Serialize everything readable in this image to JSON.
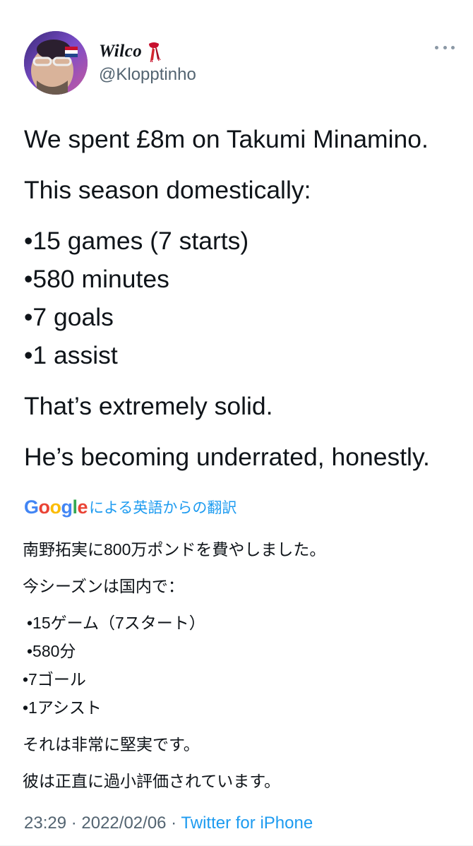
{
  "author": {
    "display_name": "Wilco",
    "handle": "@Klopptinho",
    "avatar_icon": "profile-photo",
    "name_emoji_icon": "red-scarf-icon"
  },
  "tweet": {
    "lines": [
      "We spent £8m on Takumi Minamino.",
      "This season domestically:",
      "•15 games (7 starts)",
      "•580 minutes",
      "•7 goals",
      "•1 assist",
      "That’s extremely solid.",
      "He’s becoming underrated, honestly."
    ]
  },
  "translation": {
    "provider_letters": [
      "G",
      "o",
      "o",
      "g",
      "l",
      "e"
    ],
    "label": "による英語からの翻訳",
    "lines": [
      "南野拓実に800万ポンドを費やしました。",
      "今シーズンは国内で：",
      "•15ゲーム（7スタート）",
      "•580分",
      "•7ゴール",
      "•1アシスト",
      "それは非常に堅実です。",
      "彼は正直に過小評価されています。"
    ]
  },
  "meta": {
    "time": "23:29",
    "separator": " · ",
    "date": "2022/02/06",
    "separator2": " · ",
    "source": "Twitter for iPhone"
  },
  "colors": {
    "link_blue": "#1d9bf0",
    "secondary_text": "#536471",
    "primary_text": "#0f1419"
  }
}
